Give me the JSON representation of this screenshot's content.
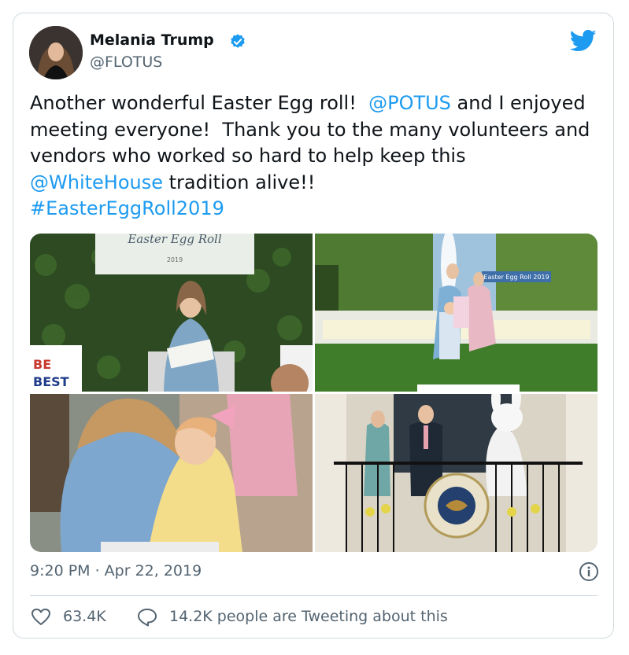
{
  "tweet": {
    "author_name": "Melania Trump",
    "author_handle": "@FLOTUS",
    "text_parts": {
      "p1": "Another wonderful Easter Egg roll!  ",
      "mention1": "@POTUS",
      "p2": " and I enjoyed meeting everyone!  Thank you to the many volunteers and vendors who worked so hard to help keep this ",
      "mention2": "@WhiteHouse",
      "p3": " tradition alive!!\n",
      "hashtag": "#EasterEggRoll2019"
    },
    "timestamp": "9:20 PM · Apr 22, 2019",
    "likes": "63.4K",
    "retweet_text": "14.2K people are Tweeting about this"
  },
  "media": {
    "banner_title": "Easter Egg Roll",
    "banner_year": "2019",
    "sign_text_line1": "BE",
    "sign_text_line2": "BEST",
    "banner2_text": "Easter Egg Roll 2019",
    "seal_text": "SEAL OF THE PRESIDENT OF THE UNITED STATES"
  },
  "icons": {
    "verified": "verified-badge-icon",
    "bird": "twitter-bird-icon",
    "info": "info-icon",
    "heart": "heart-icon",
    "reply": "reply-bubble-icon"
  },
  "colors": {
    "link": "#1d9bf0",
    "secondary_text": "#536471",
    "border": "#cfd9de"
  }
}
